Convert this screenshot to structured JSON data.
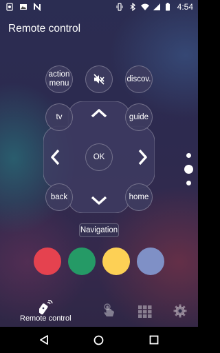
{
  "status_bar": {
    "time": "4:54"
  },
  "header": {
    "title": "Remote control"
  },
  "remote": {
    "action_menu": "action\nmenu",
    "mute_icon": "speaker-muted-icon",
    "discover": "discov.",
    "tv": "tv",
    "guide": "guide",
    "ok": "OK",
    "back": "back",
    "home": "home",
    "navigation_label": "Navigation"
  },
  "color_buttons": {
    "red": "#e5424f",
    "green": "#259a66",
    "yellow": "#fdd055",
    "blue": "#7f90c6"
  },
  "pager": {
    "pages": 3,
    "current": 2
  },
  "bottom_nav": {
    "items": [
      {
        "label": "Remote control",
        "icon": "remote-icon",
        "active": true
      },
      {
        "label": "",
        "icon": "touch-icon",
        "active": false
      },
      {
        "label": "",
        "icon": "grid-icon",
        "active": false
      },
      {
        "label": "",
        "icon": "gear-icon",
        "active": false
      }
    ]
  }
}
